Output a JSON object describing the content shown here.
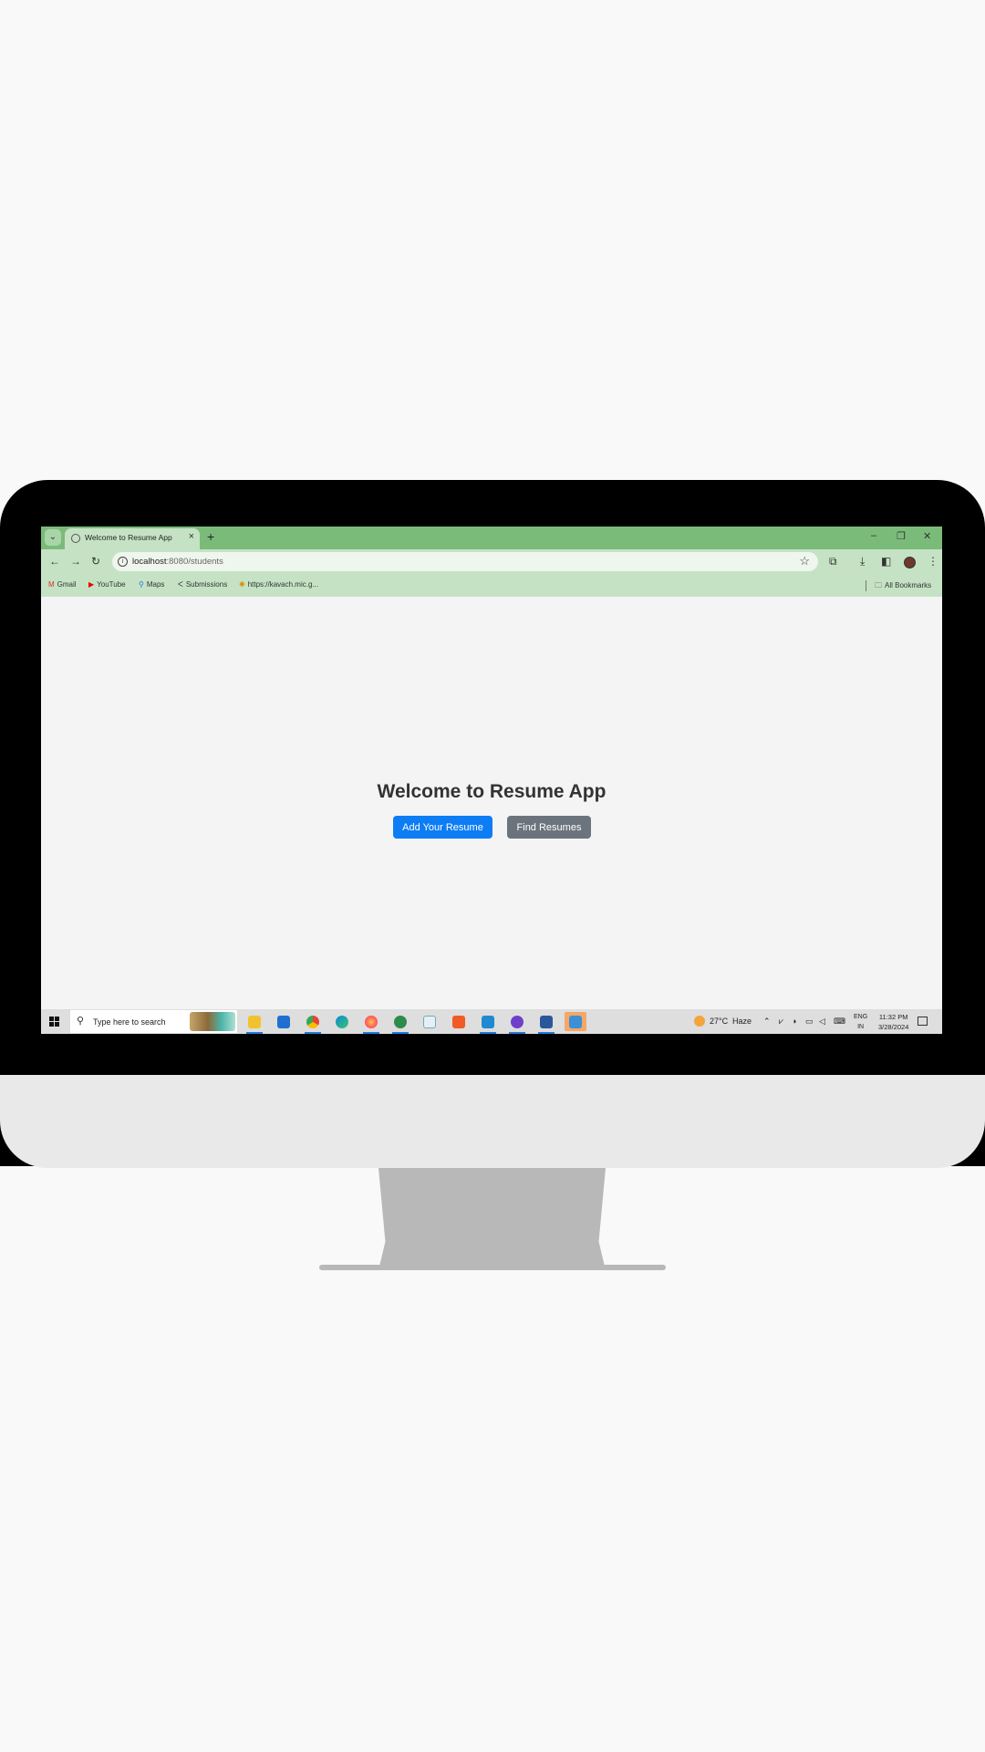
{
  "browser": {
    "tab_title": "Welcome to Resume App",
    "url_host": "localhost",
    "url_path": ":8080/students"
  },
  "bookmarks": {
    "items": [
      "Gmail",
      "YouTube",
      "Maps",
      "Submissions",
      "https://kavach.mic.g..."
    ],
    "all_label": "All Bookmarks"
  },
  "page": {
    "heading": "Welcome to Resume App",
    "add_button": "Add Your Resume",
    "find_button": "Find Resumes",
    "colors": {
      "add_button": "#0d7df5",
      "find_button": "#6b747c"
    }
  },
  "taskbar": {
    "search_placeholder": "Type here to search",
    "weather_temp": "27°C",
    "weather_desc": "Haze",
    "lang_line1": "ENG",
    "lang_line2": "IN",
    "time": "11:32 PM",
    "date": "3/28/2024",
    "apps": [
      "file-explorer",
      "mail",
      "chrome",
      "edge",
      "firefox",
      "whatsapp",
      "app-store",
      "brave",
      "vscode",
      "github-desktop",
      "word",
      "photos"
    ]
  },
  "accent_color": "#7bbb7a"
}
